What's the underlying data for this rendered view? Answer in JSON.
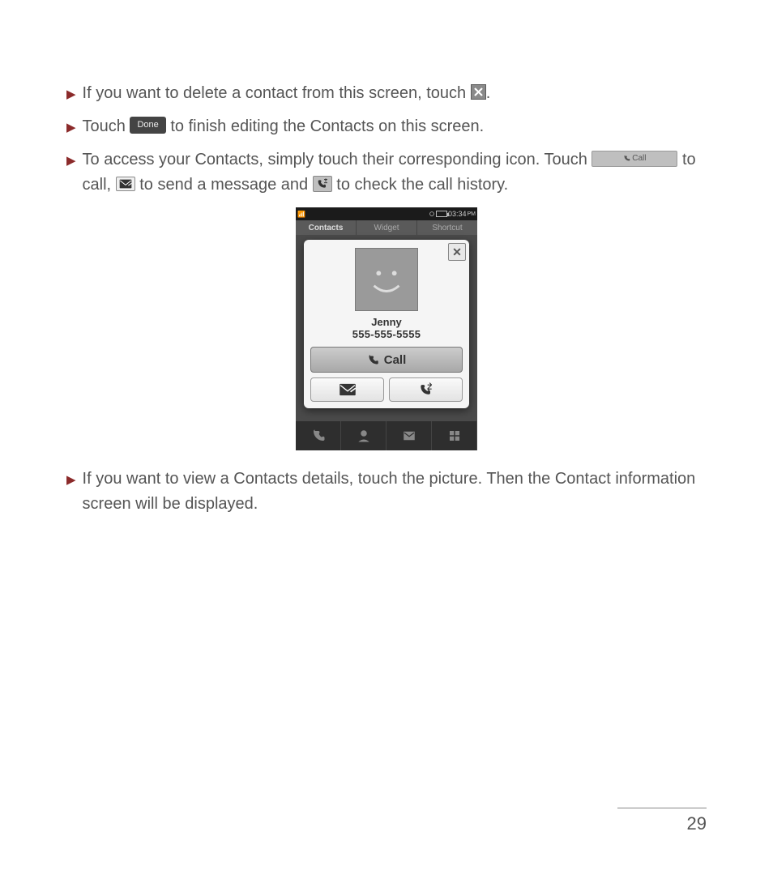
{
  "bullets": {
    "b1a": "If you want to delete a contact from this screen, touch ",
    "b1b": ".",
    "b2a": "Touch ",
    "b2b": " to finish editing the Contacts on this screen.",
    "b3a": "To access your Contacts, simply touch their corresponding icon. Touch ",
    "b3b": " to call, ",
    "b3c": " to send a message and ",
    "b3d": " to check the call history.",
    "b4": "If you want to view a Contacts details, touch the picture. Then the Contact information screen will be displayed."
  },
  "inline": {
    "done": "Done",
    "call": "Call"
  },
  "phone": {
    "time": "03:34",
    "ampm": "PM",
    "tabs": {
      "t1": "Contacts",
      "t2": "Widget",
      "t3": "Shortcut"
    },
    "contact": {
      "name": "Jenny",
      "number": "555-555-5555",
      "call_label": "Call"
    },
    "close_glyph": "✕"
  },
  "page_number": "29"
}
